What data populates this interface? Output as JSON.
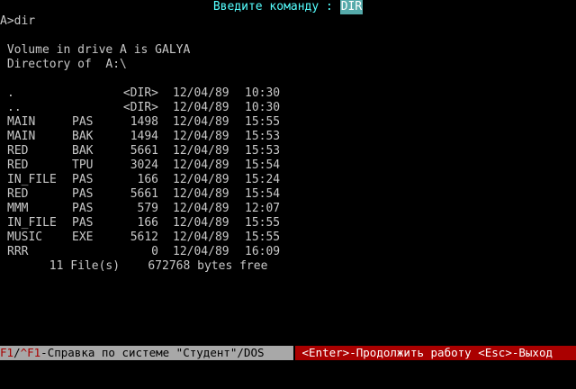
{
  "prompt": {
    "label": "Введите команду :",
    "command": "DIR"
  },
  "console": {
    "command_line": "A>dir",
    "volume_line": " Volume in drive A is GALYA",
    "directory_line": " Directory of  A:\\"
  },
  "listing": {
    "entries": [
      {
        "name": ".",
        "ext": "",
        "size": "<DIR>",
        "date": "12/04/89",
        "time": "10:30"
      },
      {
        "name": "..",
        "ext": "",
        "size": "<DIR>",
        "date": "12/04/89",
        "time": "10:30"
      },
      {
        "name": "MAIN",
        "ext": "PAS",
        "size": "1498",
        "date": "12/04/89",
        "time": "15:55"
      },
      {
        "name": "MAIN",
        "ext": "BAK",
        "size": "1494",
        "date": "12/04/89",
        "time": "15:53"
      },
      {
        "name": "RED",
        "ext": "BAK",
        "size": "5661",
        "date": "12/04/89",
        "time": "15:53"
      },
      {
        "name": "RED",
        "ext": "TPU",
        "size": "3024",
        "date": "12/04/89",
        "time": "15:54"
      },
      {
        "name": "IN_FILE",
        "ext": "PAS",
        "size": "166",
        "date": "12/04/89",
        "time": "15:24"
      },
      {
        "name": "RED",
        "ext": "PAS",
        "size": "5661",
        "date": "12/04/89",
        "time": "15:54"
      },
      {
        "name": "MMM",
        "ext": "PAS",
        "size": "579",
        "date": "12/04/89",
        "time": "12:07"
      },
      {
        "name": "IN_FILE",
        "ext": "PAS",
        "size": "166",
        "date": "12/04/89",
        "time": "15:55"
      },
      {
        "name": "MUSIC",
        "ext": "EXE",
        "size": "5612",
        "date": "12/04/89",
        "time": "15:55"
      },
      {
        "name": "RRR",
        "ext": "",
        "size": "0",
        "date": "12/04/89",
        "time": "16:09"
      }
    ],
    "summary": "       11 File(s)    672768 bytes free"
  },
  "status_bar": {
    "help_key_1": "F1",
    "help_sep": "/",
    "help_key_2": "^F1",
    "help_text": "-Справка по системе \"Студент\"/DOS",
    "continue_key": "<Enter>",
    "continue_text": "-Продолжить работу ",
    "exit_key": "<Esc>",
    "exit_text": "-Выход"
  },
  "colors": {
    "background": "#000000",
    "text": "#c8c8c8",
    "prompt": "#55ffff",
    "command_field": "#55aaaa",
    "status_left_bg": "#a8a8a8",
    "status_right_bg": "#aa0000"
  }
}
